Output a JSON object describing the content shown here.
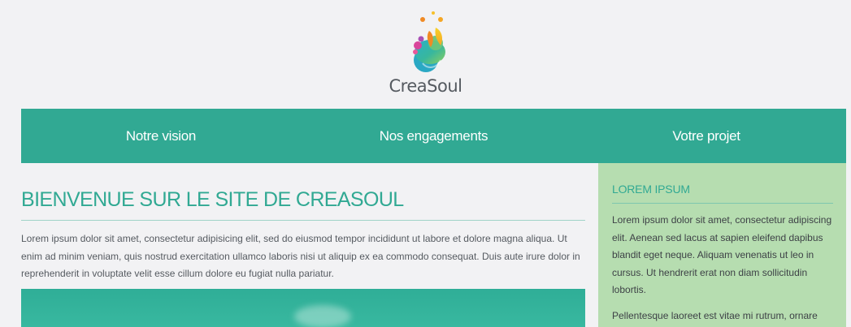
{
  "brand": {
    "name": "CreaSoul"
  },
  "nav": {
    "items": [
      "Notre vision",
      "Nos engagements",
      "Votre projet"
    ]
  },
  "main": {
    "title": "BIENVENUE SUR LE SITE DE CREASOUL",
    "paragraph": "Lorem ipsum dolor sit amet, consectetur adipisicing elit, sed do eiusmod tempor incididunt ut labore et dolore magna aliqua. Ut enim ad minim veniam, quis nostrud exercitation ullamco laboris nisi ut aliquip ex ea commodo consequat. Duis aute irure dolor in reprehenderit in voluptate velit esse cillum dolore eu fugiat nulla pariatur."
  },
  "sidebar": {
    "title": "LOREM IPSUM",
    "paragraphs": [
      "Lorem ipsum dolor sit amet, consectetur adipiscing elit. Aenean sed lacus at sapien eleifend dapibus blandit eget neque. Aliquam venenatis ut leo in cursus. Ut hendrerit erat non diam sollicitudin lobortis.",
      "Pellentesque laoreet est vitae mi rutrum, ornare"
    ]
  },
  "colors": {
    "accent": "#31a993",
    "sidebar_bg": "#b6ddb0",
    "page_bg": "#f2f2f4",
    "text": "#555a60"
  },
  "icons": {
    "logo": "creasoul-splash-logo"
  }
}
